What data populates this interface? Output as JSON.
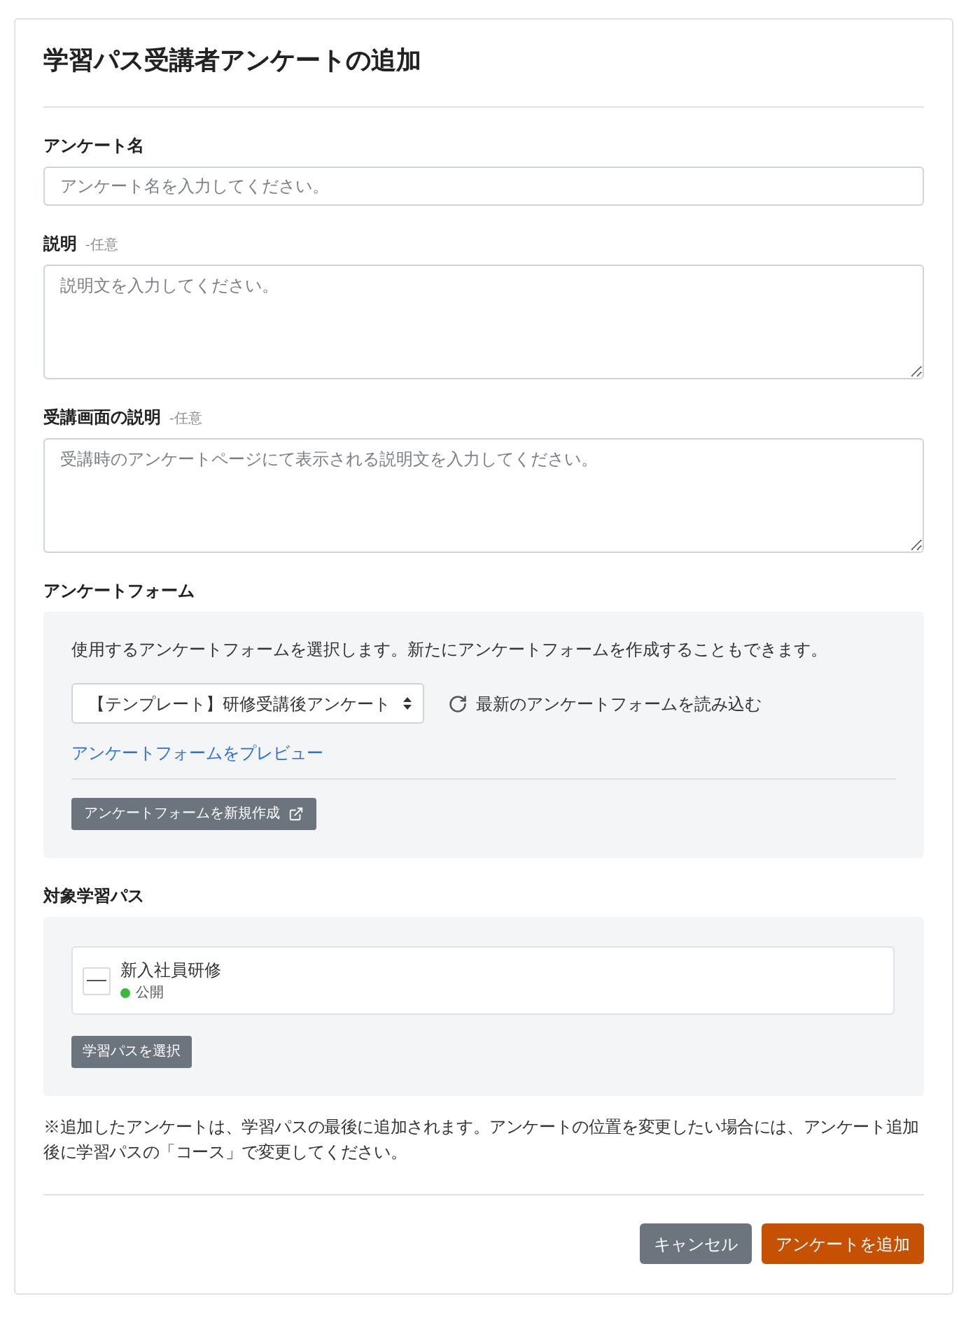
{
  "title": "学習パス受講者アンケートの追加",
  "fields": [
    {
      "kind": "input",
      "label": "アンケート名",
      "placeholder": "アンケート名を入力してください。"
    },
    {
      "kind": "textarea",
      "label": "説明",
      "optional": "-任意",
      "placeholder": "説明文を入力してください。"
    },
    {
      "kind": "textarea",
      "label": "受講画面の説明",
      "optional": "-任意",
      "placeholder": "受講時のアンケートページにて表示される説明文を入力してください。"
    }
  ],
  "form_section": {
    "label": "アンケートフォーム",
    "description": "使用するアンケートフォームを選択します。新たにアンケートフォームを作成することもできます。",
    "select": {
      "value": "【テンプレート】研修受講後アンケート"
    },
    "reload": "最新のアンケートフォームを読み込む",
    "preview_link": "アンケートフォームをプレビュー",
    "create_button": "アンケートフォームを新規作成"
  },
  "path_section": {
    "label": "対象学習パス",
    "paths": [
      {
        "name": "新入社員研修",
        "status": "公開",
        "color": "#3cb93c"
      }
    ],
    "select_button": "学習パスを選択"
  },
  "note": "※追加したアンケートは、学習パスの最後に追加されます。アンケートの位置を変更したい場合には、アンケート追加後に学習パスの「コース」で変更してください。",
  "buttons": [
    {
      "kind": "secondary",
      "label": "キャンセル"
    },
    {
      "kind": "primary",
      "label": "アンケートを追加"
    }
  ]
}
